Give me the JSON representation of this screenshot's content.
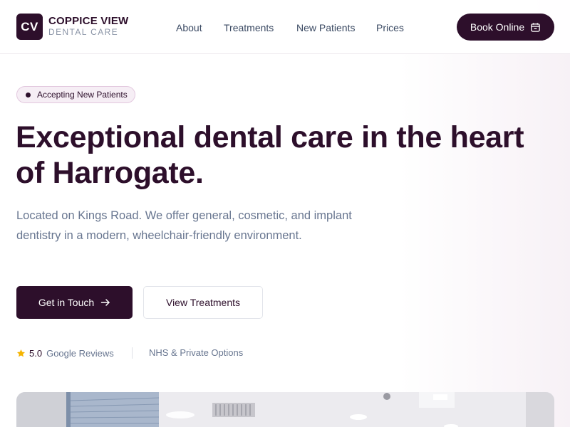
{
  "brand": {
    "logo_initials": "CV",
    "name": "COPPICE VIEW",
    "subtitle": "DENTAL CARE"
  },
  "nav": {
    "items": [
      {
        "label": "About"
      },
      {
        "label": "Treatments"
      },
      {
        "label": "New Patients"
      },
      {
        "label": "Prices"
      }
    ],
    "book_label": "Book Online",
    "book_icon": "calendar-icon"
  },
  "hero": {
    "badge": "Accepting New Patients",
    "headline": "Exceptional dental care in the heart of Harrogate.",
    "subtext": "Located on Kings Road. We offer general, cosmetic, and implant dentistry in a modern, wheelchair-friendly environment.",
    "primary_cta": "Get in Touch",
    "primary_cta_icon": "arrow-right-icon",
    "secondary_cta": "View Treatments",
    "rating_score": "5.0",
    "rating_label": "Google Reviews",
    "rating_icon": "star-icon",
    "nhs_text": "NHS & Private Options"
  },
  "colors": {
    "brand": "#2d0f2b",
    "muted_text": "#687690",
    "star": "#f5b400",
    "badge_bg": "#f6eef5"
  }
}
